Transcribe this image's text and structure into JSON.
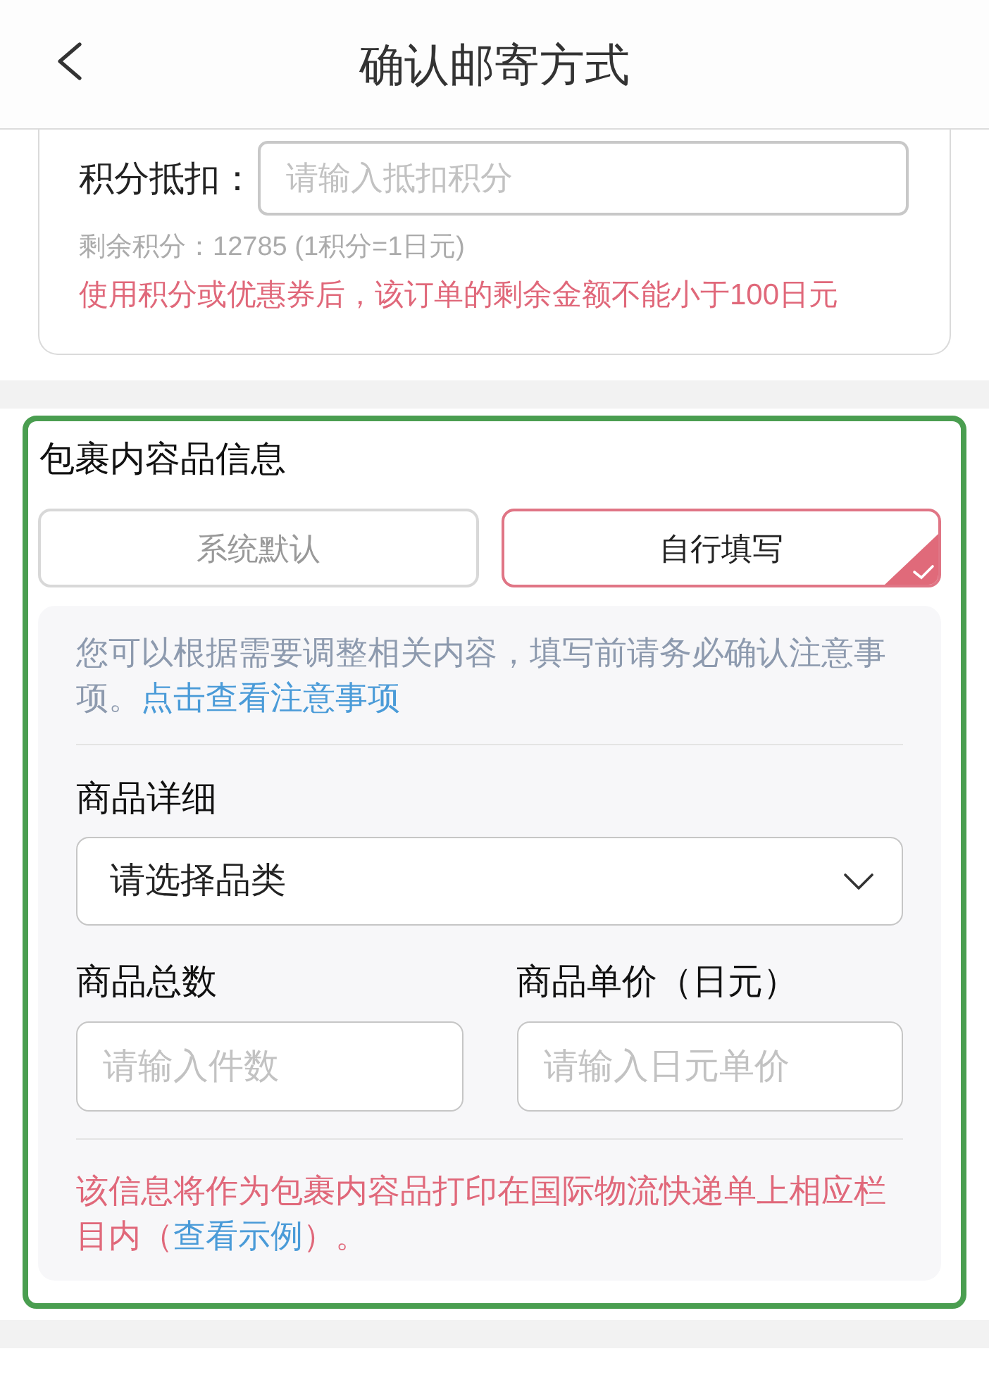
{
  "header": {
    "title": "确认邮寄方式"
  },
  "points": {
    "label": "积分抵扣：",
    "placeholder": "请输入抵扣积分",
    "balance": "剩余积分：12785 (1积分=1日元)",
    "warning": "使用积分或优惠券后，该订单的剩余金额不能小于100日元"
  },
  "contents_section": {
    "title": "包裹内容品信息",
    "options": [
      {
        "label": "系统默认",
        "selected": false
      },
      {
        "label": "自行填写",
        "selected": true
      }
    ],
    "notice": {
      "text": "您可以根据需要调整相关内容，填写前请务必确认注意事项。",
      "link": "点击查看注意事项"
    },
    "detail_label": "商品详细",
    "category_select": {
      "value": "请选择品类"
    },
    "quantity": {
      "label": "商品总数",
      "placeholder": "请输入件数"
    },
    "unit_price": {
      "label": "商品单价（日元）",
      "placeholder": "请输入日元单价"
    },
    "footnote": {
      "before": "该信息将作为包裹内容品打印在国际物流快递单上相应栏目内（",
      "link": "查看示例",
      "after": "）。"
    }
  }
}
